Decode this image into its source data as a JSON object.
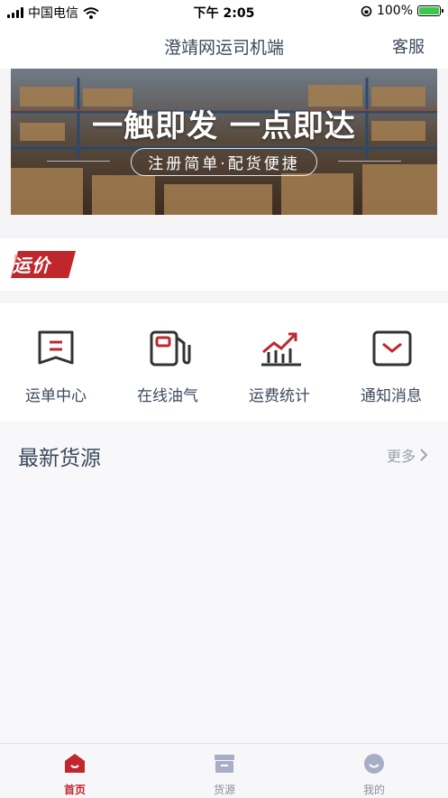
{
  "status_bar": {
    "carrier": "中国电信",
    "time": "下午 2:05",
    "battery": "100%",
    "battery_level": 1.0
  },
  "header": {
    "title": "澄靖网运司机端",
    "service_label": "客服"
  },
  "banner": {
    "headline": "一触即发 一点即达",
    "subtitle": "注册简单·配货便捷"
  },
  "freight": {
    "tag_label": "运价"
  },
  "menu": {
    "items": [
      {
        "label": "运单中心",
        "icon": "waybill-icon"
      },
      {
        "label": "在线油气",
        "icon": "fuel-pump-icon"
      },
      {
        "label": "运费统计",
        "icon": "chart-trend-icon"
      },
      {
        "label": "通知消息",
        "icon": "message-icon"
      }
    ]
  },
  "cargo": {
    "title": "最新货源",
    "more_label": "更多"
  },
  "tab_bar": {
    "tabs": [
      {
        "label": "首页",
        "icon": "home-icon",
        "active": true
      },
      {
        "label": "货源",
        "icon": "cargo-box-icon",
        "active": false
      },
      {
        "label": "我的",
        "icon": "profile-icon",
        "active": false
      }
    ]
  },
  "colors": {
    "accent": "#c0272d",
    "text_primary": "#3c4a5c",
    "text_muted": "#8a8f99"
  }
}
